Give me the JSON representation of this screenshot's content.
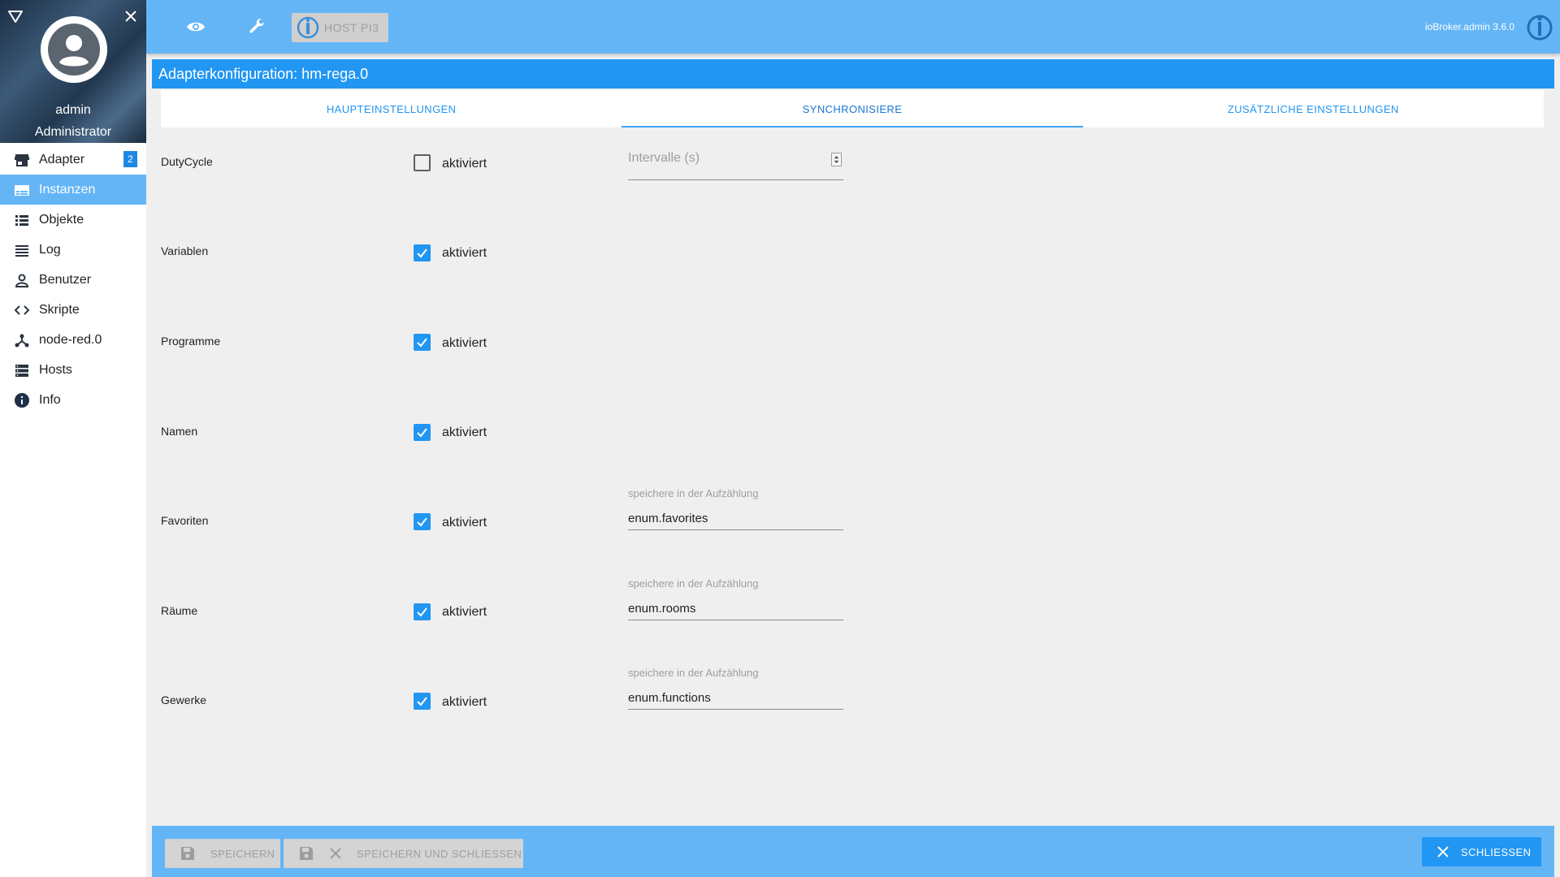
{
  "user": {
    "name": "admin",
    "role": "Administrator"
  },
  "nav": {
    "items": [
      {
        "label": "Adapter",
        "icon": "store-icon",
        "badge": "2"
      },
      {
        "label": "Instanzen",
        "icon": "instances-icon",
        "active": true
      },
      {
        "label": "Objekte",
        "icon": "list-icon"
      },
      {
        "label": "Log",
        "icon": "log-icon"
      },
      {
        "label": "Benutzer",
        "icon": "person-icon"
      },
      {
        "label": "Skripte",
        "icon": "code-icon"
      },
      {
        "label": "node-red.0",
        "icon": "node-red-icon"
      },
      {
        "label": "Hosts",
        "icon": "hosts-icon"
      },
      {
        "label": "Info",
        "icon": "info-icon"
      }
    ]
  },
  "topbar": {
    "host_label": "HOST PI3",
    "version": "ioBroker.admin 3.6.0"
  },
  "title": "Adapterkonfiguration: hm-rega.0",
  "tabs": [
    {
      "label": "HAUPTEINSTELLUNGEN"
    },
    {
      "label": "SYNCHRONISIERE",
      "active": true
    },
    {
      "label": "ZUSÄTZLICHE EINSTELLUNGEN"
    }
  ],
  "rows": [
    {
      "label": "DutyCycle",
      "checked": false,
      "check_label": "aktiviert"
    },
    {
      "label": "Variablen",
      "checked": true,
      "check_label": "aktiviert"
    },
    {
      "label": "Programme",
      "checked": true,
      "check_label": "aktiviert"
    },
    {
      "label": "Namen",
      "checked": true,
      "check_label": "aktiviert"
    },
    {
      "label": "Favoriten",
      "checked": true,
      "check_label": "aktiviert"
    },
    {
      "label": "Räume",
      "checked": true,
      "check_label": "aktiviert"
    },
    {
      "label": "Gewerke",
      "checked": true,
      "check_label": "aktiviert"
    }
  ],
  "interval": {
    "placeholder": "Intervalle (s)"
  },
  "enum_fields": {
    "favorites": {
      "label": "speichere in der Aufzählung",
      "value": "enum.favorites"
    },
    "rooms": {
      "label": "speichere in der Aufzählung",
      "value": "enum.rooms"
    },
    "functions": {
      "label": "speichere in der Aufzählung",
      "value": "enum.functions"
    }
  },
  "bottombar": {
    "save_label": "SPEICHERN",
    "save_close_label": "SPEICHERN UND SCHLIESSEN",
    "close_label": "SCHLIESSEN"
  },
  "colors": {
    "topbar": "#64b5f6",
    "accent": "#2196f3",
    "active_nav": "#64b5f6"
  }
}
